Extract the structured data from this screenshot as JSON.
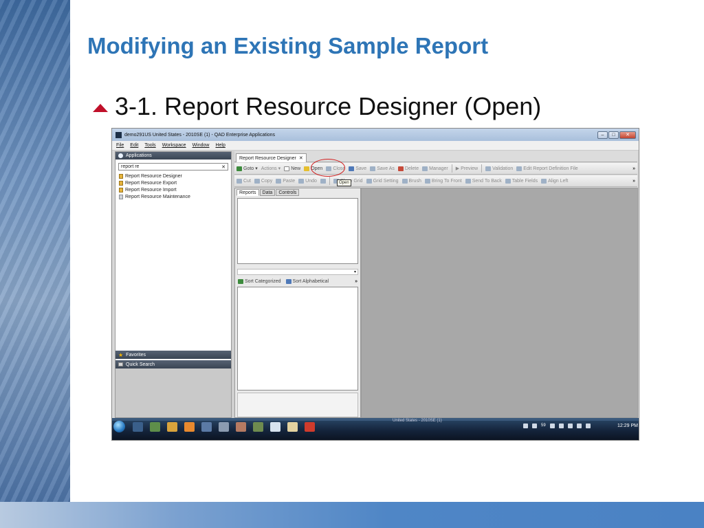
{
  "slide": {
    "title": "Modifying an Existing Sample Report",
    "bullet": "3-1.  Report Resource Designer (Open)"
  },
  "app": {
    "window_title": "demo291US United States - 2010SE (1) - QAD Enterprise Applications",
    "window_buttons": [
      "–",
      "□",
      "✕"
    ],
    "menu": [
      "File",
      "Edit",
      "Tools",
      "Workspace",
      "Window",
      "Help"
    ],
    "applications_header": "Applications",
    "search_value": "report re",
    "search_clear": "✕",
    "results": [
      "Report Resource Designer",
      "Report Resource Export",
      "Report Resource Import",
      "Report Resource Maintenance"
    ],
    "favorites": "Favorites",
    "quick_search": "Quick Search",
    "tab_title": "Report Resource Designer",
    "tab_close": "✕",
    "toolbar1": {
      "goto": "Goto",
      "actions": "Actions",
      "new": "New",
      "open": "Open",
      "close": "Close",
      "save": "Save",
      "save_as": "Save As",
      "delete": "Delete",
      "manager": "Manager",
      "preview": "Preview",
      "validation": "Validation",
      "edit_def": "Edit Report Definition File"
    },
    "toolbar2": {
      "cut": "Cut",
      "copy": "Copy",
      "paste": "Paste",
      "undo": "Undo",
      "show_grid": "Show Grid",
      "grid_setting": "Grid Setting",
      "brush": "Brush",
      "bring_front": "Bring To Front",
      "send_back": "Send To Back",
      "table_fields": "Table Fields",
      "align_left": "Align Left"
    },
    "more": "»",
    "tooltip": "Open",
    "subtabs": [
      "Reports",
      "Data",
      "Controls"
    ],
    "sort_categorized": "Sort Categorized",
    "sort_alphabetical": "Sort Alphabetical",
    "clock": "12:29 PM",
    "taskbar_label": "United States - 2010SE (1)",
    "tray_count": "59"
  },
  "colors": {
    "title": "#2e75b6",
    "bullet": "#c0102a",
    "highlight_ring": "#d21d1d"
  }
}
